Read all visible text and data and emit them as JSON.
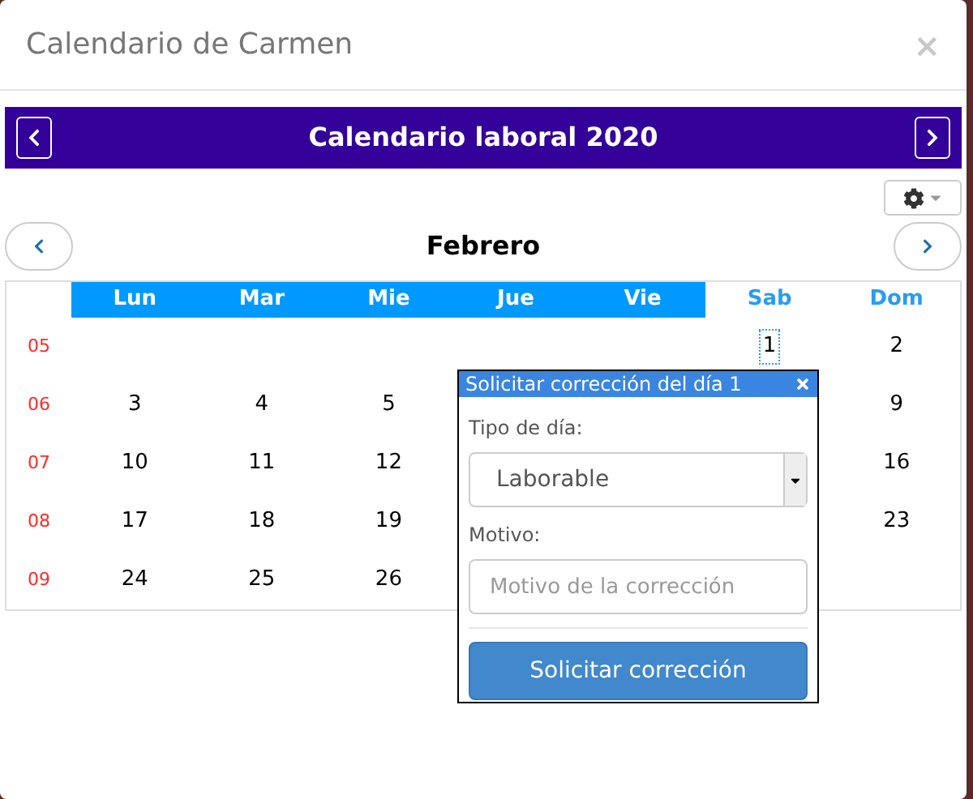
{
  "dialog": {
    "title": "Calendario de Carmen",
    "close": "×"
  },
  "year_bar": {
    "title": "Calendario laboral 2020"
  },
  "month": {
    "title": "Febrero"
  },
  "weekdays": [
    {
      "label": "Lun",
      "kind": "workday"
    },
    {
      "label": "Mar",
      "kind": "workday"
    },
    {
      "label": "Mie",
      "kind": "workday"
    },
    {
      "label": "Jue",
      "kind": "workday"
    },
    {
      "label": "Vie",
      "kind": "workday"
    },
    {
      "label": "Sab",
      "kind": "weekend"
    },
    {
      "label": "Dom",
      "kind": "weekend"
    }
  ],
  "weeks": [
    {
      "week": "05",
      "days": [
        {
          "kind": "empty"
        },
        {
          "kind": "empty"
        },
        {
          "kind": "empty"
        },
        {
          "kind": "empty"
        },
        {
          "kind": "empty"
        },
        {
          "kind": "day",
          "label": "1",
          "selected": true
        },
        {
          "kind": "day",
          "label": "2",
          "selected": false
        }
      ]
    },
    {
      "week": "06",
      "days": [
        {
          "kind": "day",
          "label": "3",
          "selected": false
        },
        {
          "kind": "day",
          "label": "4",
          "selected": false
        },
        {
          "kind": "day",
          "label": "5",
          "selected": false
        },
        {
          "kind": "empty"
        },
        {
          "kind": "empty"
        },
        {
          "kind": "empty"
        },
        {
          "kind": "day",
          "label": "9",
          "selected": false
        }
      ]
    },
    {
      "week": "07",
      "days": [
        {
          "kind": "day",
          "label": "10",
          "selected": false
        },
        {
          "kind": "day",
          "label": "11",
          "selected": false
        },
        {
          "kind": "day",
          "label": "12",
          "selected": false
        },
        {
          "kind": "empty"
        },
        {
          "kind": "empty"
        },
        {
          "kind": "empty"
        },
        {
          "kind": "day",
          "label": "16",
          "selected": false
        }
      ]
    },
    {
      "week": "08",
      "days": [
        {
          "kind": "day",
          "label": "17",
          "selected": false
        },
        {
          "kind": "day",
          "label": "18",
          "selected": false
        },
        {
          "kind": "day",
          "label": "19",
          "selected": false
        },
        {
          "kind": "empty"
        },
        {
          "kind": "empty"
        },
        {
          "kind": "empty"
        },
        {
          "kind": "day",
          "label": "23",
          "selected": false
        }
      ]
    },
    {
      "week": "09",
      "days": [
        {
          "kind": "day",
          "label": "24",
          "selected": false
        },
        {
          "kind": "day",
          "label": "25",
          "selected": false
        },
        {
          "kind": "day",
          "label": "26",
          "selected": false
        }
      ]
    }
  ],
  "popover": {
    "title": "Solicitar corrección del día 1",
    "type_label": "Tipo de día:",
    "type_value": "Laborable",
    "reason_label": "Motivo:",
    "reason_placeholder": "Motivo de la corrección",
    "submit": "Solicitar corrección"
  }
}
